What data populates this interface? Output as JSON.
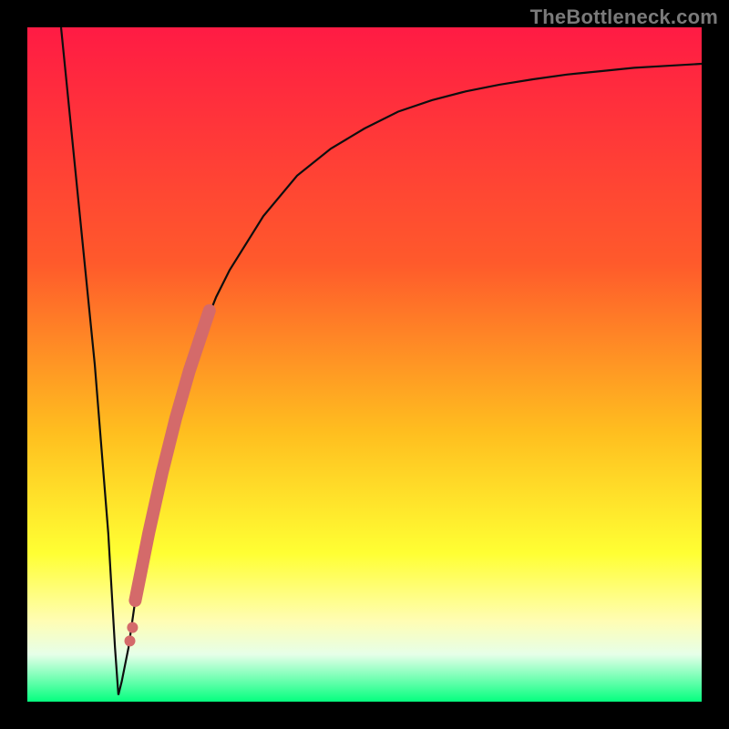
{
  "attribution": "TheBottleneck.com",
  "colors": {
    "gradient_top": "#ff1b44",
    "gradient_mid1": "#ff5a2b",
    "gradient_mid2": "#ffbe1f",
    "gradient_mid3": "#ffff33",
    "gradient_mid4": "#fffdb3",
    "gradient_band": "#e6ffe9",
    "gradient_bottom": "#05ff7f",
    "curve": "#0e0e0e",
    "marker": "#d46a6a",
    "frame": "#000000"
  },
  "chart_data": {
    "type": "line",
    "title": "",
    "xlabel": "",
    "ylabel": "",
    "xlim": [
      0,
      100
    ],
    "ylim": [
      0,
      100
    ],
    "grid": false,
    "series": [
      {
        "name": "bottleneck-curve",
        "x": [
          5,
          8,
          10,
          12,
          13,
          13.5,
          14,
          15,
          16,
          18,
          20,
          22,
          24,
          26,
          28,
          30,
          35,
          40,
          45,
          50,
          55,
          60,
          65,
          70,
          75,
          80,
          85,
          90,
          95,
          100
        ],
        "y": [
          100,
          70,
          50,
          25,
          8,
          1,
          3,
          8,
          15,
          25,
          34,
          42,
          49,
          55,
          60,
          64,
          72,
          78,
          82,
          85,
          87.5,
          89.2,
          90.5,
          91.5,
          92.3,
          93,
          93.5,
          94,
          94.3,
          94.6
        ]
      }
    ],
    "markers": {
      "name": "highlight-segment",
      "x": [
        16,
        17,
        18,
        19,
        20,
        21,
        22,
        23,
        24,
        25,
        26,
        27,
        15.2,
        15.6
      ],
      "y": [
        15,
        20,
        25,
        29.5,
        34,
        38,
        42,
        45.5,
        49,
        52,
        55,
        58,
        9,
        11
      ]
    }
  }
}
